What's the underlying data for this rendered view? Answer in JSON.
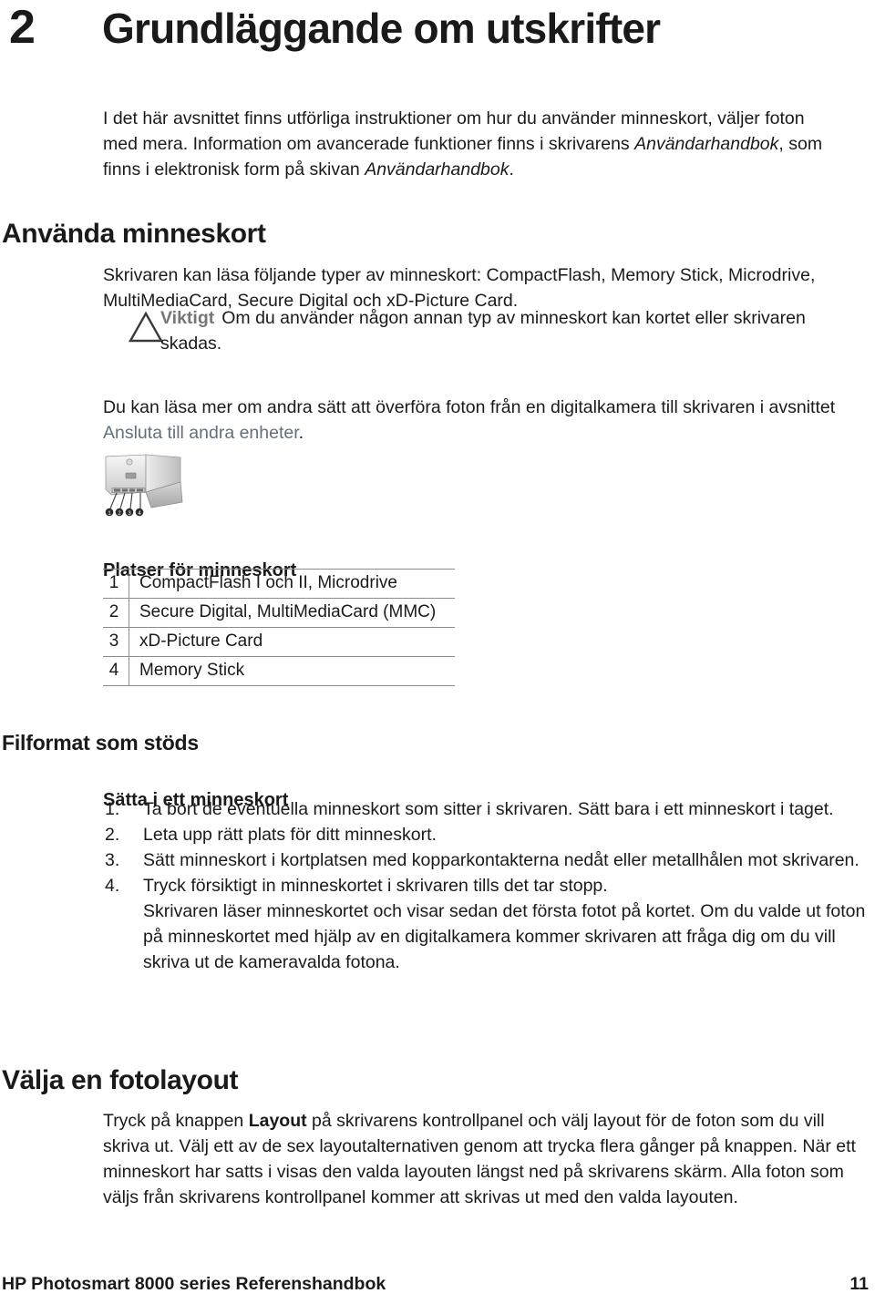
{
  "chapter": {
    "number": "2",
    "title": "Grundläggande om utskrifter"
  },
  "intro": {
    "line1": "I det här avsnittet finns utförliga instruktioner om hur du använder minneskort, väljer foton med mera. Information om avancerade funktioner finns i skrivarens ",
    "italic1": "Användarhandbok",
    "line2": ", som finns i elektronisk form på skivan ",
    "italic2": "Användarhandbok",
    "line3": "."
  },
  "sections": {
    "anvanda_minneskort": {
      "heading": "Använda minneskort",
      "paragraph": "Skrivaren kan läsa följande typer av minneskort: CompactFlash, Memory Stick, Microdrive, MultiMediaCard, Secure Digital och xD-Picture Card.",
      "caution": {
        "label": "Viktigt",
        "text": "Om du använder någon annan typ av minneskort kan kortet eller skrivaren skadas.",
        "icon": "warning-triangle-icon",
        "label_color": "#76767a"
      },
      "transfer_paragraph": {
        "before": "Du kan läsa mer om andra sätt att överföra foton från en digitalkamera till skrivaren i avsnittet ",
        "link": "Ansluta till andra enheter",
        "after": ".",
        "link_color": "#61707a"
      },
      "figure": {
        "name": "printer-card-slots-illustration",
        "callouts": [
          "1",
          "2",
          "3",
          "4"
        ]
      },
      "slots_table": {
        "heading": "Platser för minneskort",
        "rows": [
          {
            "num": "1",
            "label": "CompactFlash I och II, Microdrive"
          },
          {
            "num": "2",
            "label": "Secure Digital, MultiMediaCard (MMC)"
          },
          {
            "num": "3",
            "label": "xD-Picture Card"
          },
          {
            "num": "4",
            "label": "Memory Stick"
          }
        ]
      }
    },
    "filformat": {
      "heading": "Filformat som stöds",
      "sub_heading": "Sätta i ett minneskort",
      "steps": [
        {
          "num": "1.",
          "text": "Ta bort de eventuella minneskort som sitter i skrivaren. Sätt bara i ett minneskort i taget."
        },
        {
          "num": "2.",
          "text": "Leta upp rätt plats för ditt minneskort."
        },
        {
          "num": "3.",
          "text": "Sätt minneskort i kortplatsen med kopparkontakterna nedåt eller metallhålen mot skrivaren."
        },
        {
          "num": "4.",
          "text": "Tryck försiktigt in minneskortet i skrivaren tills det tar stopp.",
          "extra": "Skrivaren läser minneskortet och visar sedan det första fotot på kortet. Om du valde ut foton på minneskortet med hjälp av en digitalkamera kommer skrivaren att fråga dig om du vill skriva ut de kameravalda fotona."
        }
      ]
    },
    "valja_fotolayout": {
      "heading": "Välja en fotolayout",
      "paragraph": {
        "before": "Tryck på knappen ",
        "bold": "Layout",
        "after": " på skrivarens kontrollpanel och välj layout för de foton som du vill skriva ut. Välj ett av de sex layoutalternativen genom att trycka flera gånger på knappen. När ett minneskort har satts i visas den valda layouten längst ned på skrivarens skärm. Alla foton som väljs från skrivarens kontrollpanel kommer att skrivas ut med den valda layouten."
      }
    }
  },
  "footer": {
    "title": "HP Photosmart 8000 series Referenshandbok",
    "page": "11"
  }
}
